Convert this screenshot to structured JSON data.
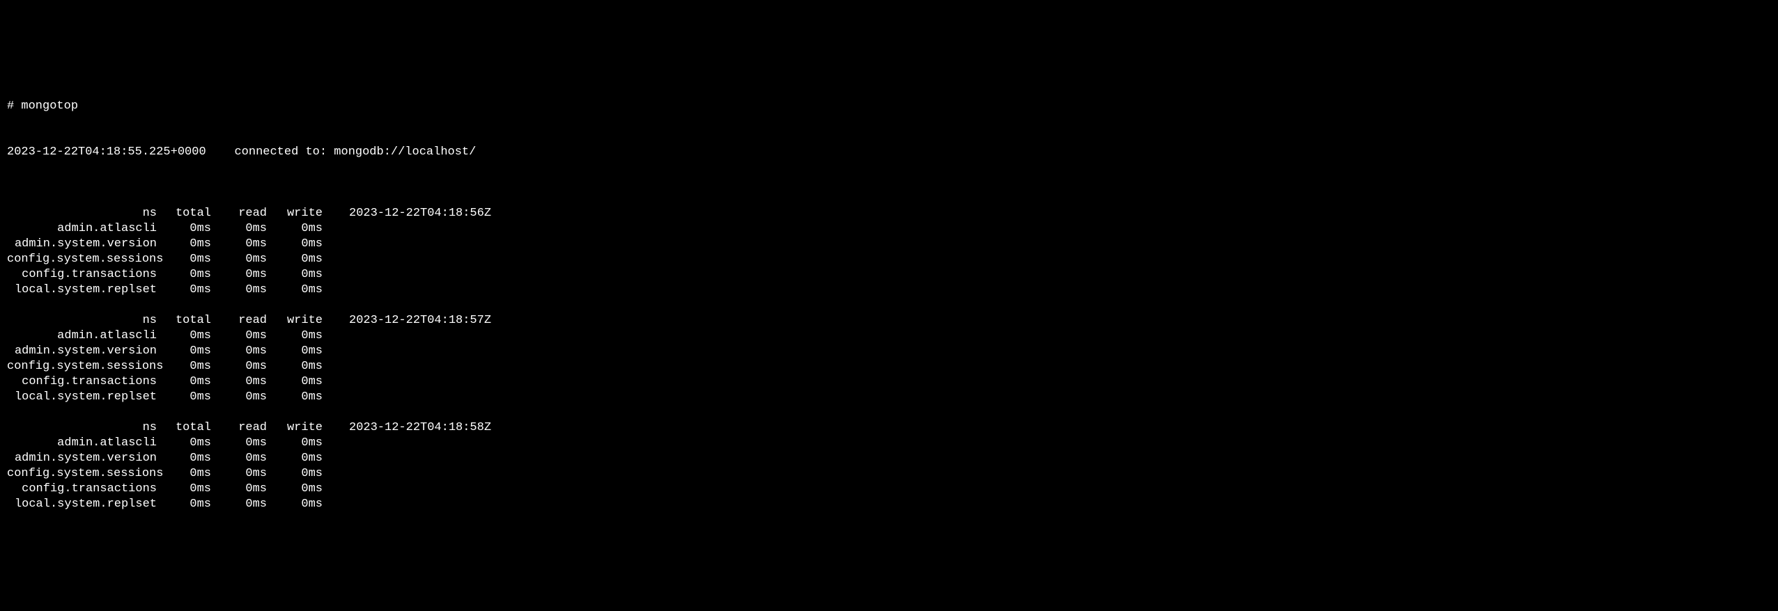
{
  "prompt": "# mongotop",
  "connection": {
    "timestamp": "2023-12-22T04:18:55.225+0000",
    "spacer": "    ",
    "message": "connected to: mongodb://localhost/"
  },
  "headers": {
    "ns": "ns",
    "total": "total",
    "read": "read",
    "write": "write"
  },
  "blocks": [
    {
      "timestamp": "2023-12-22T04:18:56Z",
      "rows": [
        {
          "ns": "admin.atlascli",
          "total": "0ms",
          "read": "0ms",
          "write": "0ms"
        },
        {
          "ns": "admin.system.version",
          "total": "0ms",
          "read": "0ms",
          "write": "0ms"
        },
        {
          "ns": "config.system.sessions",
          "total": "0ms",
          "read": "0ms",
          "write": "0ms"
        },
        {
          "ns": "config.transactions",
          "total": "0ms",
          "read": "0ms",
          "write": "0ms"
        },
        {
          "ns": "local.system.replset",
          "total": "0ms",
          "read": "0ms",
          "write": "0ms"
        }
      ]
    },
    {
      "timestamp": "2023-12-22T04:18:57Z",
      "rows": [
        {
          "ns": "admin.atlascli",
          "total": "0ms",
          "read": "0ms",
          "write": "0ms"
        },
        {
          "ns": "admin.system.version",
          "total": "0ms",
          "read": "0ms",
          "write": "0ms"
        },
        {
          "ns": "config.system.sessions",
          "total": "0ms",
          "read": "0ms",
          "write": "0ms"
        },
        {
          "ns": "config.transactions",
          "total": "0ms",
          "read": "0ms",
          "write": "0ms"
        },
        {
          "ns": "local.system.replset",
          "total": "0ms",
          "read": "0ms",
          "write": "0ms"
        }
      ]
    },
    {
      "timestamp": "2023-12-22T04:18:58Z",
      "rows": [
        {
          "ns": "admin.atlascli",
          "total": "0ms",
          "read": "0ms",
          "write": "0ms"
        },
        {
          "ns": "admin.system.version",
          "total": "0ms",
          "read": "0ms",
          "write": "0ms"
        },
        {
          "ns": "config.system.sessions",
          "total": "0ms",
          "read": "0ms",
          "write": "0ms"
        },
        {
          "ns": "config.transactions",
          "total": "0ms",
          "read": "0ms",
          "write": "0ms"
        },
        {
          "ns": "local.system.replset",
          "total": "0ms",
          "read": "0ms",
          "write": "0ms"
        }
      ]
    }
  ]
}
